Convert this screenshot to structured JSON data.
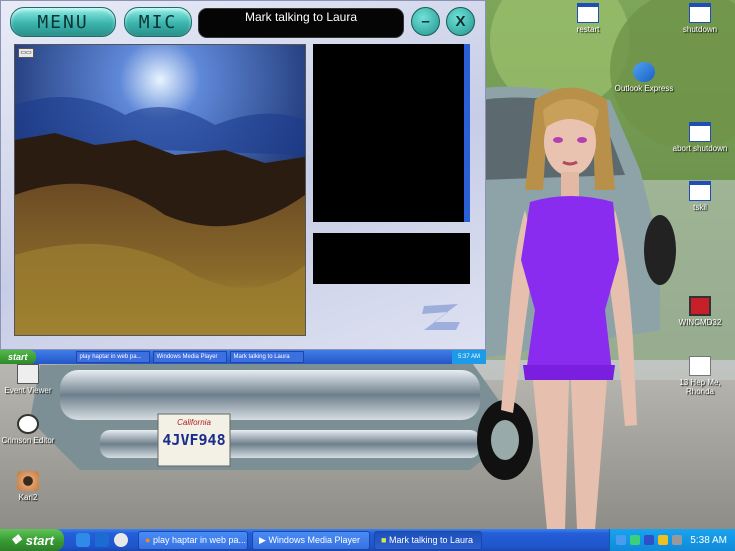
{
  "app": {
    "menu_label": "MENU",
    "mic_label": "MIC",
    "title": "Mark talking to Laura",
    "minimize_label": "–",
    "close_label": "X"
  },
  "mini_taskbar": {
    "start_label": "start",
    "buttons": [
      "play haptar in web pa...",
      "Windows Media Player",
      "Mark talking to Laura"
    ],
    "clock": "5:37 AM"
  },
  "desktop": {
    "icons": [
      {
        "label": "restart"
      },
      {
        "label": "shutdown"
      },
      {
        "label": "Outlook Express"
      },
      {
        "label": "abort shutdown"
      },
      {
        "label": "tskil"
      },
      {
        "label": "WINCMD32"
      },
      {
        "label": "13 Hep Me, Rhonda"
      },
      {
        "label": "Event Viewer"
      },
      {
        "label": "Crimson Editor"
      },
      {
        "label": "Kari2"
      }
    ],
    "license_plate": "4JVF948",
    "plate_state": "California"
  },
  "taskbar": {
    "start_label": "start",
    "buttons": [
      "play haptar in web pa...",
      "Windows Media Player",
      "Mark talking to Laura"
    ],
    "clock": "5:38 AM"
  },
  "colors": {
    "accent": "#3ab4ad",
    "taskbar": "#245ed8",
    "start": "#379a32"
  }
}
